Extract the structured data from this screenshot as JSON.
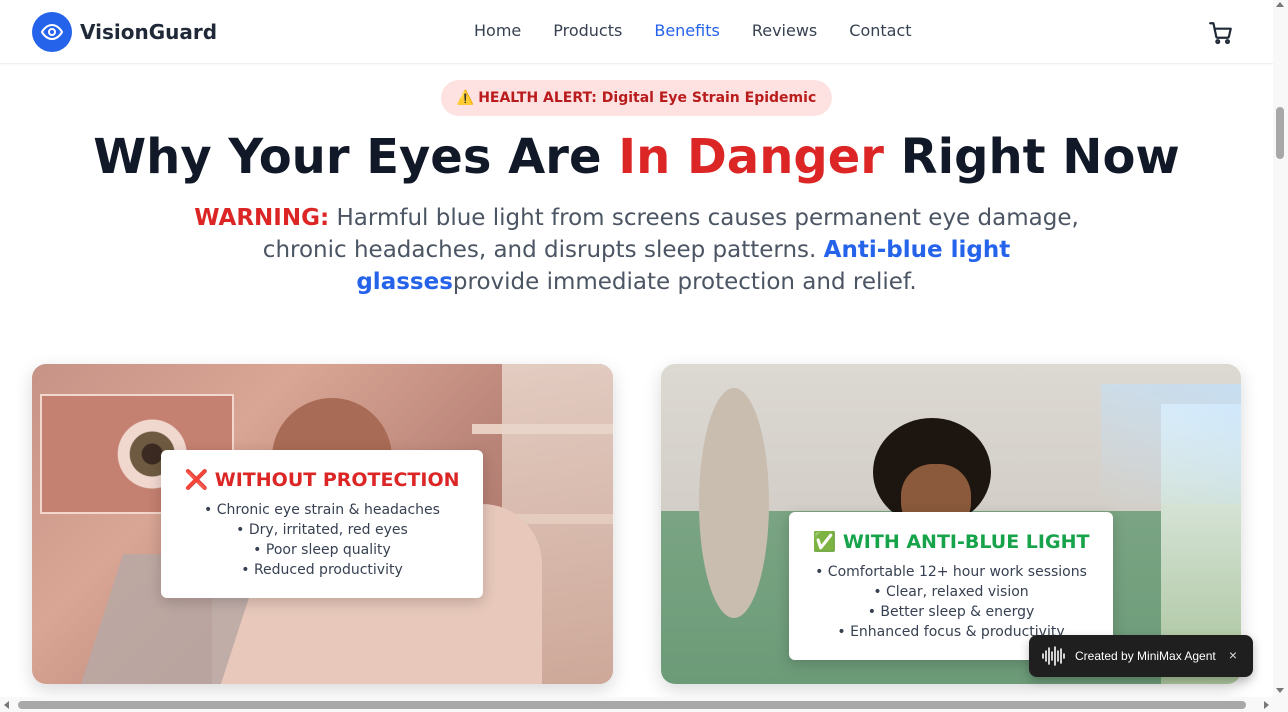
{
  "brand": {
    "name": "VisionGuard",
    "logo_icon": "eye-icon",
    "accent": "#2563eb"
  },
  "nav": {
    "items": [
      {
        "label": "Home",
        "active": false
      },
      {
        "label": "Products",
        "active": false
      },
      {
        "label": "Benefits",
        "active": true
      },
      {
        "label": "Reviews",
        "active": false
      },
      {
        "label": "Contact",
        "active": false
      }
    ],
    "cart_icon": "cart-icon"
  },
  "hero": {
    "alert_icon": "⚠️",
    "alert_text": "HEALTH ALERT: Digital Eye Strain Epidemic",
    "headline_start": "Why Your Eyes Are ",
    "headline_highlight": "In Danger",
    "headline_end": " Right Now",
    "warning_label": "WARNING:",
    "warning_text": " Harmful blue light from screens causes permanent eye damage, chronic headaches, and disrupts sleep patterns. ",
    "highlight_text": "Anti-blue light glasses",
    "closing_text": "provide immediate protection and relief.",
    "danger_color": "#dc2626"
  },
  "cards": {
    "without": {
      "icon": "❌",
      "title": "WITHOUT PROTECTION",
      "items": [
        "• Chronic eye strain & headaches",
        "• Dry, irritated, red eyes",
        "• Poor sleep quality",
        "• Reduced productivity"
      ],
      "color": "#dc2626"
    },
    "with": {
      "icon": "✅",
      "title": "WITH ANTI-BLUE LIGHT",
      "items": [
        "• Comfortable 12+ hour work sessions",
        "• Clear, relaxed vision",
        "• Better sleep & energy",
        "• Enhanced focus & productivity"
      ],
      "color": "#16a34a"
    }
  },
  "agent_badge": {
    "label": "Created by MiniMax Agent",
    "close": "×",
    "icon": "waveform-icon"
  }
}
